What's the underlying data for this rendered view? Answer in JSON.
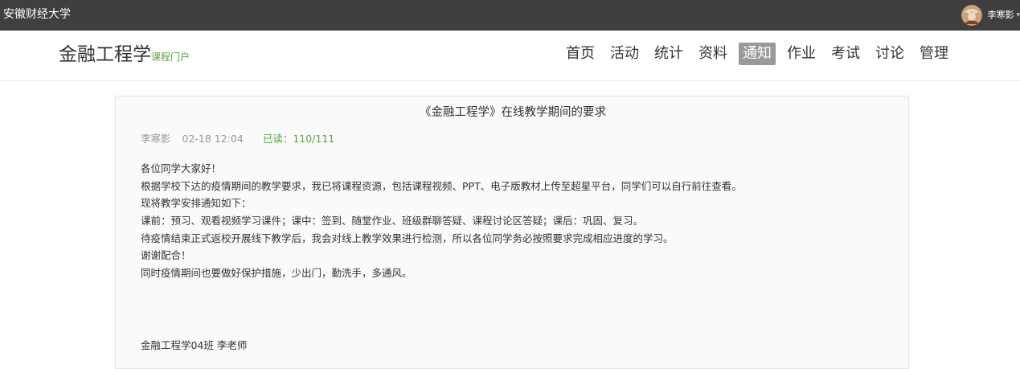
{
  "topbar": {
    "school_name": "安徽财经大学",
    "user_name": "李寒影",
    "caret_icon": "chevron-down-icon"
  },
  "header": {
    "course_name": "金融工程学",
    "portal_label": "课程门户",
    "accent_color": "#5ba342"
  },
  "nav": {
    "items": [
      {
        "label": "首页"
      },
      {
        "label": "活动"
      },
      {
        "label": "统计"
      },
      {
        "label": "资料"
      },
      {
        "label": "通知",
        "active": true
      },
      {
        "label": "作业"
      },
      {
        "label": "考试"
      },
      {
        "label": "讨论"
      },
      {
        "label": "管理"
      }
    ]
  },
  "notice": {
    "title": "《金融工程学》在线教学期间的要求",
    "author": "李寒影",
    "time": "02-18 12:04",
    "read_status": "已读：110/111",
    "lines": [
      "各位同学大家好！",
      "根据学校下达的疫情期间的教学要求，我已将课程资源，包括课程视频、PPT、电子版教材上传至超星平台，同学们可以自行前往查看。",
      "现将教学安排通知如下：",
      "课前：预习、观看视频学习课件；课中：签到、随堂作业、班级群聊答疑、课程讨论区答疑；课后：巩固、复习。",
      "待疫情结束正式返校开展线下教学后，我会对线上教学效果进行检测，所以各位同学务必按照要求完成相应进度的学习。",
      "谢谢配合！",
      "同时疫情期间也要做好保护措施，少出门，勤洗手，多通风。"
    ],
    "signature": "金融工程学04班 李老师"
  }
}
